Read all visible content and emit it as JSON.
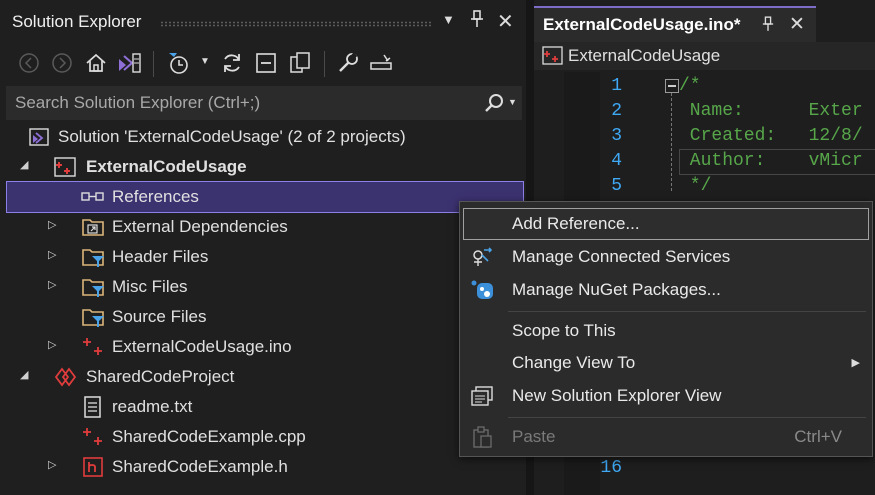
{
  "solution_explorer": {
    "title": "Solution Explorer",
    "search_placeholder": "Search Solution Explorer (Ctrl+;)",
    "tree": [
      {
        "label": "Solution 'ExternalCodeUsage' (2 of 2 projects)",
        "icon": "solution-icon"
      },
      {
        "label": "ExternalCodeUsage",
        "icon": "arduino-project-icon",
        "expanded": true,
        "bold": true
      },
      {
        "label": "References",
        "icon": "references-icon",
        "selected": true
      },
      {
        "label": "External Dependencies",
        "icon": "external-dependencies-folder-icon"
      },
      {
        "label": "Header Files",
        "icon": "filter-folder-icon"
      },
      {
        "label": "Misc Files",
        "icon": "filter-folder-icon"
      },
      {
        "label": "Source Files",
        "icon": "filter-folder-icon"
      },
      {
        "label": "ExternalCodeUsage.ino",
        "icon": "ino-file-icon"
      },
      {
        "label": "SharedCodeProject",
        "icon": "shared-project-icon",
        "expanded": true
      },
      {
        "label": "readme.txt",
        "icon": "text-file-icon"
      },
      {
        "label": "SharedCodeExample.cpp",
        "icon": "cpp-file-icon"
      },
      {
        "label": "SharedCodeExample.h",
        "icon": "header-file-icon"
      }
    ]
  },
  "editor": {
    "tab_title": "ExternalCodeUsage.ino*",
    "nav_label": "ExternalCodeUsage",
    "lines": [
      {
        "num": "1",
        "text": "/*"
      },
      {
        "num": "2",
        "text": " Name:      Exter"
      },
      {
        "num": "3",
        "text": " Created:   12/8/"
      },
      {
        "num": "4",
        "text": " Author:    vMicr"
      },
      {
        "num": "5",
        "text": " */"
      }
    ],
    "last_line_num": "16"
  },
  "context_menu": {
    "items": [
      {
        "label": "Add Reference...",
        "highlighted": true
      },
      {
        "label": "Manage Connected Services",
        "icon": "connected-services-icon"
      },
      {
        "label": "Manage NuGet Packages...",
        "icon": "nuget-icon"
      },
      {
        "label": "Scope to This"
      },
      {
        "label": "Change View To",
        "submenu": true
      },
      {
        "label": "New Solution Explorer View",
        "icon": "new-view-icon"
      },
      {
        "label": "Paste",
        "shortcut": "Ctrl+V",
        "disabled": true,
        "icon": "paste-icon"
      }
    ]
  },
  "colors": {
    "accent": "#7e6dc7",
    "selection": "#3b3270",
    "line_numbers": "#3fa9f5",
    "comment": "#57a64a"
  }
}
